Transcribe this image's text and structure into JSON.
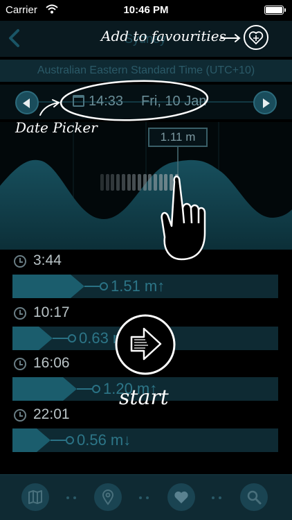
{
  "status_bar": {
    "carrier": "Carrier",
    "time": "10:46 PM"
  },
  "nav": {
    "back_icon": "chevron-left-icon",
    "title": "Sydney"
  },
  "timezone": "Australian Eastern Standard Time (UTC+10)",
  "date_picker": {
    "time": "14:33",
    "date": "Fri, 10 Jan",
    "prev_icon": "triangle-left-icon",
    "next_icon": "triangle-right-icon",
    "calendar_icon": "calendar-icon"
  },
  "chart": {
    "current_height": "1.11 m",
    "wave_color": "#134652"
  },
  "tides": [
    {
      "time": "3:44",
      "value": "1.51 m↑",
      "level": 0.22
    },
    {
      "time": "10:17",
      "value": "0.63 m↓",
      "level": 0.1
    },
    {
      "time": "16:06",
      "value": "1.20 m↑",
      "level": 0.19
    },
    {
      "time": "22:01",
      "value": "0.56 m↓",
      "level": 0.09
    }
  ],
  "tab_bar": {
    "items": [
      {
        "icon": "map-icon"
      },
      {
        "icon": "location-pin-icon"
      },
      {
        "icon": "heart-icon"
      },
      {
        "icon": "search-icon"
      }
    ]
  },
  "annotations": {
    "favourites": "Add to favourities",
    "date_picker": "Date Picker",
    "start": "start"
  },
  "colors": {
    "background": "#000000",
    "accent": "#1b5d6d",
    "bar_bg": "#0e2a33"
  }
}
